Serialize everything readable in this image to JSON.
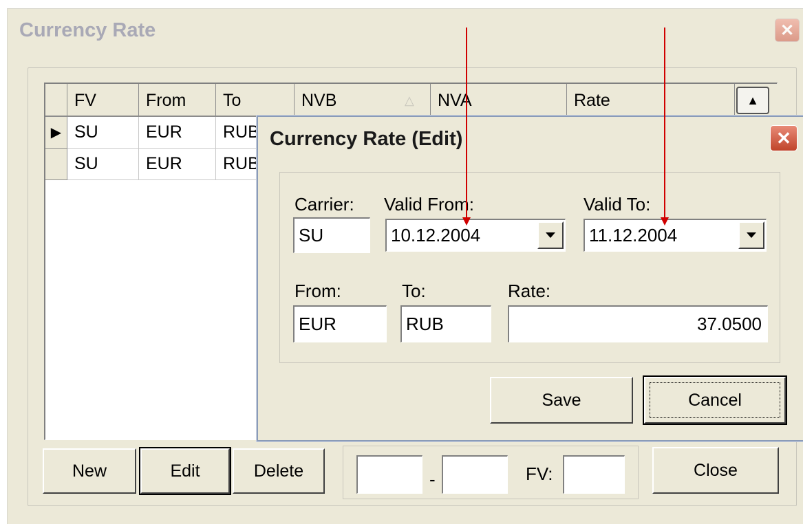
{
  "window": {
    "title": "Currency Rate",
    "close_glyph": "✕"
  },
  "grid": {
    "columns": [
      "FV",
      "From",
      "To",
      "NVB",
      "NVA",
      "Rate"
    ],
    "sort_indicator": "△",
    "scroll_up_glyph": "▲",
    "row_indicator": "▶",
    "rows": [
      {
        "fv": "SU",
        "from": "EUR",
        "to": "RUB"
      },
      {
        "fv": "SU",
        "from": "EUR",
        "to": "RUB"
      }
    ]
  },
  "bottom": {
    "new_label": "New",
    "edit_label": "Edit",
    "delete_label": "Delete",
    "dash": "-",
    "fv_label": "FV:",
    "range_from_value": "",
    "range_to_value": "",
    "fv_value": "",
    "close_label": "Close"
  },
  "dialog": {
    "title": "Currency Rate (Edit)",
    "close_glyph": "✕",
    "carrier_label": "Carrier:",
    "carrier_value": "SU",
    "valid_from_label": "Valid From:",
    "valid_from_value": "10.12.2004",
    "valid_to_label": "Valid To:",
    "valid_to_value": "11.12.2004",
    "from_label": "From:",
    "from_value": "EUR",
    "to_label": "To:",
    "to_value": "RUB",
    "rate_label": "Rate:",
    "rate_value": "37.0500",
    "save_label": "Save",
    "cancel_label": "Cancel"
  },
  "annotation_color": "#d00000"
}
